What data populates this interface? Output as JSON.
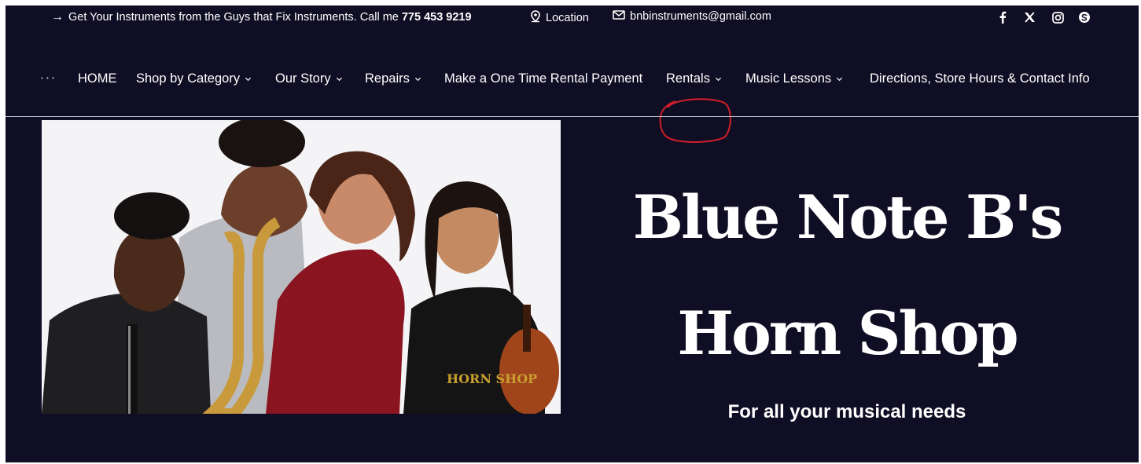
{
  "topbar": {
    "promo_text": "Get Your Instruments from the Guys that Fix Instruments. Call me",
    "phone": "775 453 9219",
    "location_label": "Location",
    "email": "bnbinstruments@gmail.com",
    "social_icons": [
      "facebook-icon",
      "x-icon",
      "instagram-icon",
      "skype-icon"
    ]
  },
  "nav": {
    "items": [
      {
        "label": "HOME",
        "has_dropdown": false
      },
      {
        "label": "Shop by Category",
        "has_dropdown": true
      },
      {
        "label": "Our Story",
        "has_dropdown": true
      },
      {
        "label": "Repairs",
        "has_dropdown": true
      },
      {
        "label": "Make a One Time Rental Payment",
        "has_dropdown": false
      },
      {
        "label": "Rentals",
        "has_dropdown": true,
        "highlighted": true
      },
      {
        "label": "Music Lessons",
        "has_dropdown": true
      },
      {
        "label": "Directions, Store Hours & Contact Info",
        "has_dropdown": false
      }
    ]
  },
  "hero": {
    "title_line1": "Blue Note B's",
    "title_line2": "Horn Shop",
    "tagline": "For all your musical needs",
    "shirt_text": "HORN SHOP"
  },
  "colors": {
    "background": "#100e24",
    "text": "#ffffff",
    "highlight_circle": "#d11f2a"
  }
}
